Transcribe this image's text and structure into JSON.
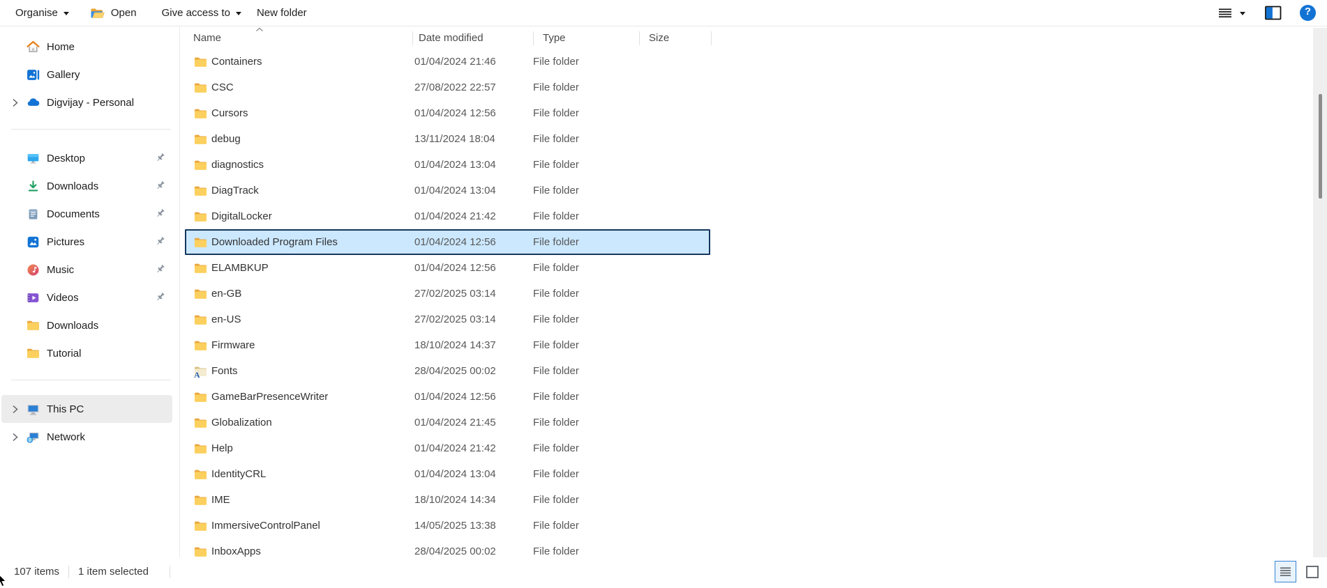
{
  "toolbar": {
    "organise": "Organise",
    "open": "Open",
    "give_access_to": "Give access to",
    "new_folder": "New folder"
  },
  "sidebar": {
    "home": {
      "label": "Home"
    },
    "gallery": {
      "label": "Gallery"
    },
    "onedrive": {
      "label": "Digvijay - Personal"
    },
    "pinned": [
      {
        "label": "Desktop",
        "icon": "desktop",
        "pinned": true
      },
      {
        "label": "Downloads",
        "icon": "downloads",
        "pinned": true
      },
      {
        "label": "Documents",
        "icon": "documents",
        "pinned": true
      },
      {
        "label": "Pictures",
        "icon": "pictures",
        "pinned": true
      },
      {
        "label": "Music",
        "icon": "music",
        "pinned": true
      },
      {
        "label": "Videos",
        "icon": "videos",
        "pinned": true
      }
    ],
    "folders": [
      {
        "label": "Downloads",
        "icon": "folder"
      },
      {
        "label": "Tutorial",
        "icon": "folder"
      }
    ],
    "this_pc": {
      "label": "This PC",
      "selected": true
    },
    "network": {
      "label": "Network"
    }
  },
  "list": {
    "columns": {
      "name": "Name",
      "date_modified": "Date modified",
      "type": "Type",
      "size": "Size"
    },
    "sort": {
      "column": "Name",
      "direction": "ascending"
    },
    "rows": [
      {
        "name": "Containers",
        "date": "01/04/2024 21:46",
        "type": "File folder",
        "icon": "folder",
        "selected": false
      },
      {
        "name": "CSC",
        "date": "27/08/2022 22:57",
        "type": "File folder",
        "icon": "folder",
        "selected": false
      },
      {
        "name": "Cursors",
        "date": "01/04/2024 12:56",
        "type": "File folder",
        "icon": "folder",
        "selected": false
      },
      {
        "name": "debug",
        "date": "13/11/2024 18:04",
        "type": "File folder",
        "icon": "folder",
        "selected": false
      },
      {
        "name": "diagnostics",
        "date": "01/04/2024 13:04",
        "type": "File folder",
        "icon": "folder",
        "selected": false
      },
      {
        "name": "DiagTrack",
        "date": "01/04/2024 13:04",
        "type": "File folder",
        "icon": "folder",
        "selected": false
      },
      {
        "name": "DigitalLocker",
        "date": "01/04/2024 21:42",
        "type": "File folder",
        "icon": "folder",
        "selected": false
      },
      {
        "name": "Downloaded Program Files",
        "date": "01/04/2024 12:56",
        "type": "File folder",
        "icon": "folder",
        "selected": true
      },
      {
        "name": "ELAMBKUP",
        "date": "01/04/2024 12:56",
        "type": "File folder",
        "icon": "folder",
        "selected": false
      },
      {
        "name": "en-GB",
        "date": "27/02/2025 03:14",
        "type": "File folder",
        "icon": "folder",
        "selected": false
      },
      {
        "name": "en-US",
        "date": "27/02/2025 03:14",
        "type": "File folder",
        "icon": "folder",
        "selected": false
      },
      {
        "name": "Firmware",
        "date": "18/10/2024 14:37",
        "type": "File folder",
        "icon": "folder",
        "selected": false
      },
      {
        "name": "Fonts",
        "date": "28/04/2025 00:02",
        "type": "File folder",
        "icon": "folder-fonts",
        "selected": false
      },
      {
        "name": "GameBarPresenceWriter",
        "date": "01/04/2024 12:56",
        "type": "File folder",
        "icon": "folder",
        "selected": false
      },
      {
        "name": "Globalization",
        "date": "01/04/2024 21:45",
        "type": "File folder",
        "icon": "folder",
        "selected": false
      },
      {
        "name": "Help",
        "date": "01/04/2024 21:42",
        "type": "File folder",
        "icon": "folder",
        "selected": false
      },
      {
        "name": "IdentityCRL",
        "date": "01/04/2024 13:04",
        "type": "File folder",
        "icon": "folder",
        "selected": false
      },
      {
        "name": "IME",
        "date": "18/10/2024 14:34",
        "type": "File folder",
        "icon": "folder",
        "selected": false
      },
      {
        "name": "ImmersiveControlPanel",
        "date": "14/05/2025 13:38",
        "type": "File folder",
        "icon": "folder",
        "selected": false
      },
      {
        "name": "InboxApps",
        "date": "28/04/2025 00:02",
        "type": "File folder",
        "icon": "folder",
        "selected": false
      }
    ]
  },
  "status_bar": {
    "items_count": "107 items",
    "selection": "1 item selected",
    "view_mode": "details"
  },
  "colors": {
    "accent": "#1273d4",
    "selection_bg": "#cce8ff",
    "selection_border": "#15375e",
    "folder_yellow": "#fcd05e",
    "scrollbar_thumb": "#8c8c8c",
    "sidebar_selected_bg": "#ececec"
  }
}
